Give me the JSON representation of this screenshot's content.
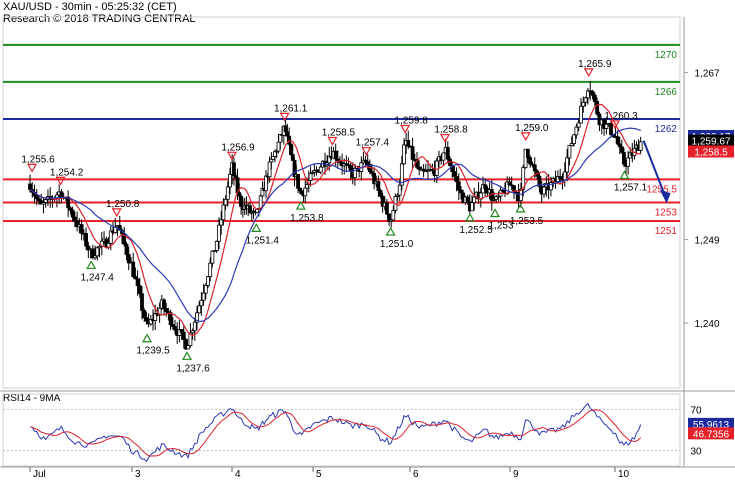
{
  "header": {
    "title": "XAU/USD - 30min - 05:25:32 (CET)",
    "subtitle": "Research © 2018 TRADING CENTRAL"
  },
  "rsi_panel": {
    "title": "RSI14 - 9MA"
  },
  "colors": {
    "support": "#e8202a",
    "resistance_green": "#1f8a1f",
    "pivot_blue": "#1c2a9e",
    "candle_up": "#ffffff",
    "candle_down": "#000000",
    "ma_fast": "#d9232e",
    "ma_slow": "#2a3bb5",
    "arrow": "#1c2a9e",
    "axis_bg": "#ffffff"
  },
  "chart_data": [
    {
      "type": "candlestick",
      "instrument": "XAU/USD",
      "timeframe": "30min",
      "x_ticks": [
        "Jul",
        "3",
        "4",
        "5",
        "6",
        "9",
        "10"
      ],
      "y_ticks": [
        "1,240",
        "1,249",
        "1,267"
      ],
      "ylim": [
        1233,
        1273
      ],
      "key_levels": [
        {
          "label": "1270",
          "value": 1270,
          "kind": "resistance",
          "color": "#1f8a1f"
        },
        {
          "label": "1266",
          "value": 1266,
          "kind": "resistance",
          "color": "#1f8a1f"
        },
        {
          "label": "1262",
          "value": 1262,
          "kind": "pivot",
          "color": "#1c2a9e"
        },
        {
          "label": "1255.5",
          "value": 1255.5,
          "kind": "support",
          "color": "#e8202a"
        },
        {
          "label": "1253",
          "value": 1253,
          "kind": "support",
          "color": "#e8202a"
        },
        {
          "label": "1251",
          "value": 1251,
          "kind": "support",
          "color": "#e8202a"
        }
      ],
      "price_boxes": [
        {
          "label": "1,260.17",
          "value": 1260.17,
          "style": "blue"
        },
        {
          "label": "1,259.67",
          "value": 1259.67,
          "style": "black"
        },
        {
          "label": "1,258.5",
          "value": 1258.5,
          "style": "red"
        }
      ],
      "extremes": [
        {
          "label": "1,255.6",
          "value": 1255.6,
          "day": 0.02,
          "type": "high"
        },
        {
          "label": "1,254.2",
          "value": 1254.2,
          "day": 0.3,
          "type": "high"
        },
        {
          "label": "1,250.8",
          "value": 1250.8,
          "day": 0.85,
          "type": "high"
        },
        {
          "label": "1,247.4",
          "value": 1247.4,
          "day": 0.6,
          "type": "low"
        },
        {
          "label": "1,239.5",
          "value": 1239.5,
          "day": 1.15,
          "type": "low"
        },
        {
          "label": "1,237.6",
          "value": 1237.6,
          "day": 1.55,
          "type": "low"
        },
        {
          "label": "1,256.9",
          "value": 1256.9,
          "day": 2.0,
          "type": "high"
        },
        {
          "label": "1,251.4",
          "value": 1251.4,
          "day": 2.3,
          "type": "low"
        },
        {
          "label": "1,261.1",
          "value": 1261.1,
          "day": 2.65,
          "type": "high"
        },
        {
          "label": "1,253.8",
          "value": 1253.8,
          "day": 2.85,
          "type": "low"
        },
        {
          "label": "1,258.5",
          "value": 1258.5,
          "day": 3.2,
          "type": "high"
        },
        {
          "label": "1,257.4",
          "value": 1257.4,
          "day": 3.55,
          "type": "high"
        },
        {
          "label": "1,251.0",
          "value": 1251.0,
          "day": 3.8,
          "type": "low"
        },
        {
          "label": "1,259.8",
          "value": 1259.8,
          "day": 3.95,
          "type": "high"
        },
        {
          "label": "1,258.8",
          "value": 1258.8,
          "day": 4.35,
          "type": "high"
        },
        {
          "label": "1,252.5",
          "value": 1252.5,
          "day": 4.6,
          "type": "low"
        },
        {
          "label": "1,253",
          "value": 1253,
          "day": 4.85,
          "type": "low"
        },
        {
          "label": "1,259.0",
          "value": 1259.0,
          "day": 5.15,
          "type": "high"
        },
        {
          "label": "1,253.5",
          "value": 1253.5,
          "day": 5.1,
          "type": "low"
        },
        {
          "label": "1,265.9",
          "value": 1265.9,
          "day": 5.75,
          "type": "high"
        },
        {
          "label": "1,260.3",
          "value": 1260.3,
          "day": 6.0,
          "type": "high"
        },
        {
          "label": "1,257.1",
          "value": 1257.1,
          "day": 6.1,
          "type": "low"
        }
      ],
      "price_path": [
        [
          0.0,
          1255.0
        ],
        [
          0.1,
          1252.5
        ],
        [
          0.3,
          1254.2
        ],
        [
          0.45,
          1251.0
        ],
        [
          0.6,
          1247.4
        ],
        [
          0.75,
          1248.8
        ],
        [
          0.85,
          1250.8
        ],
        [
          1.0,
          1246.0
        ],
        [
          1.15,
          1239.5
        ],
        [
          1.3,
          1242.0
        ],
        [
          1.45,
          1239.2
        ],
        [
          1.55,
          1237.6
        ],
        [
          1.7,
          1243.0
        ],
        [
          1.85,
          1249.0
        ],
        [
          2.0,
          1256.9
        ],
        [
          2.1,
          1253.0
        ],
        [
          2.3,
          1251.4
        ],
        [
          2.45,
          1256.5
        ],
        [
          2.65,
          1261.1
        ],
        [
          2.75,
          1257.0
        ],
        [
          2.85,
          1253.8
        ],
        [
          3.0,
          1256.0
        ],
        [
          3.2,
          1258.5
        ],
        [
          3.4,
          1256.0
        ],
        [
          3.55,
          1257.4
        ],
        [
          3.7,
          1253.5
        ],
        [
          3.8,
          1251.0
        ],
        [
          3.9,
          1255.5
        ],
        [
          3.95,
          1259.8
        ],
        [
          4.1,
          1256.0
        ],
        [
          4.25,
          1256.5
        ],
        [
          4.35,
          1258.8
        ],
        [
          4.5,
          1254.0
        ],
        [
          4.6,
          1252.5
        ],
        [
          4.75,
          1255.0
        ],
        [
          4.85,
          1253.0
        ],
        [
          5.0,
          1255.0
        ],
        [
          5.1,
          1253.5
        ],
        [
          5.15,
          1259.0
        ],
        [
          5.3,
          1254.0
        ],
        [
          5.5,
          1256.0
        ],
        [
          5.65,
          1262.0
        ],
        [
          5.75,
          1265.9
        ],
        [
          5.85,
          1262.0
        ],
        [
          6.0,
          1260.3
        ],
        [
          6.05,
          1258.5
        ],
        [
          6.1,
          1257.1
        ],
        [
          6.2,
          1258.5
        ],
        [
          6.28,
          1259.67
        ]
      ],
      "projection": {
        "from": 1259.67,
        "to": 1255.5
      }
    },
    {
      "type": "line",
      "title": "RSI14 - 9MA",
      "y_ticks": [
        "70",
        "30"
      ],
      "ylim": [
        15,
        85
      ],
      "series": [
        {
          "name": "RSI14",
          "color": "#2a3bb5",
          "last_label": "55.9613",
          "last": 55.9613
        },
        {
          "name": "9MA",
          "color": "#d9232e",
          "last_label": "46.7356",
          "last": 46.7356
        }
      ],
      "rsi_path": [
        [
          0.0,
          55
        ],
        [
          0.15,
          40
        ],
        [
          0.3,
          52
        ],
        [
          0.45,
          38
        ],
        [
          0.6,
          35
        ],
        [
          0.75,
          45
        ],
        [
          0.9,
          43
        ],
        [
          1.0,
          30
        ],
        [
          1.15,
          22
        ],
        [
          1.3,
          35
        ],
        [
          1.45,
          28
        ],
        [
          1.55,
          24
        ],
        [
          1.7,
          48
        ],
        [
          1.85,
          62
        ],
        [
          2.0,
          72
        ],
        [
          2.1,
          60
        ],
        [
          2.3,
          50
        ],
        [
          2.45,
          62
        ],
        [
          2.65,
          70
        ],
        [
          2.75,
          52
        ],
        [
          2.85,
          44
        ],
        [
          3.0,
          55
        ],
        [
          3.2,
          62
        ],
        [
          3.4,
          54
        ],
        [
          3.55,
          56
        ],
        [
          3.7,
          42
        ],
        [
          3.8,
          38
        ],
        [
          3.9,
          55
        ],
        [
          3.95,
          64
        ],
        [
          4.1,
          52
        ],
        [
          4.25,
          56
        ],
        [
          4.35,
          60
        ],
        [
          4.5,
          44
        ],
        [
          4.6,
          38
        ],
        [
          4.75,
          50
        ],
        [
          4.85,
          42
        ],
        [
          5.0,
          48
        ],
        [
          5.1,
          42
        ],
        [
          5.15,
          60
        ],
        [
          5.3,
          46
        ],
        [
          5.5,
          52
        ],
        [
          5.65,
          68
        ],
        [
          5.75,
          74
        ],
        [
          5.85,
          60
        ],
        [
          6.0,
          48
        ],
        [
          6.05,
          38
        ],
        [
          6.1,
          35
        ],
        [
          6.2,
          42
        ],
        [
          6.28,
          55.96
        ]
      ]
    }
  ]
}
